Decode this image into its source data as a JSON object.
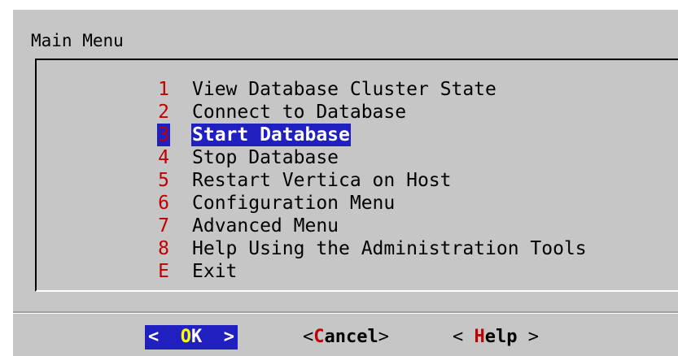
{
  "dialog": {
    "title": "Main Menu"
  },
  "menu": {
    "items": [
      {
        "key": "1",
        "label": "View Database Cluster State"
      },
      {
        "key": "2",
        "label": "Connect to Database"
      },
      {
        "key": "3",
        "label": "Start Database",
        "selected": true
      },
      {
        "key": "4",
        "label": "Stop Database"
      },
      {
        "key": "5",
        "label": "Restart Vertica on Host"
      },
      {
        "key": "6",
        "label": "Configuration Menu"
      },
      {
        "key": "7",
        "label": "Advanced Menu"
      },
      {
        "key": "8",
        "label": "Help Using the Administration Tools"
      },
      {
        "key": "E",
        "label": "Exit"
      }
    ]
  },
  "buttons": {
    "ok": {
      "left": "<  ",
      "hot": "O",
      "rest": "K",
      "right": "  >"
    },
    "cancel": {
      "left": "<",
      "hot": "C",
      "rest": "ancel",
      "right": ">"
    },
    "help": {
      "left": "< ",
      "hot": "H",
      "rest": "elp",
      "right": " >"
    }
  },
  "colors": {
    "dialog_bg": "#c6c6c6",
    "highlight_bg": "#2020c0",
    "hotkey": "#c00000",
    "ok_hotkey": "#ffff00"
  }
}
